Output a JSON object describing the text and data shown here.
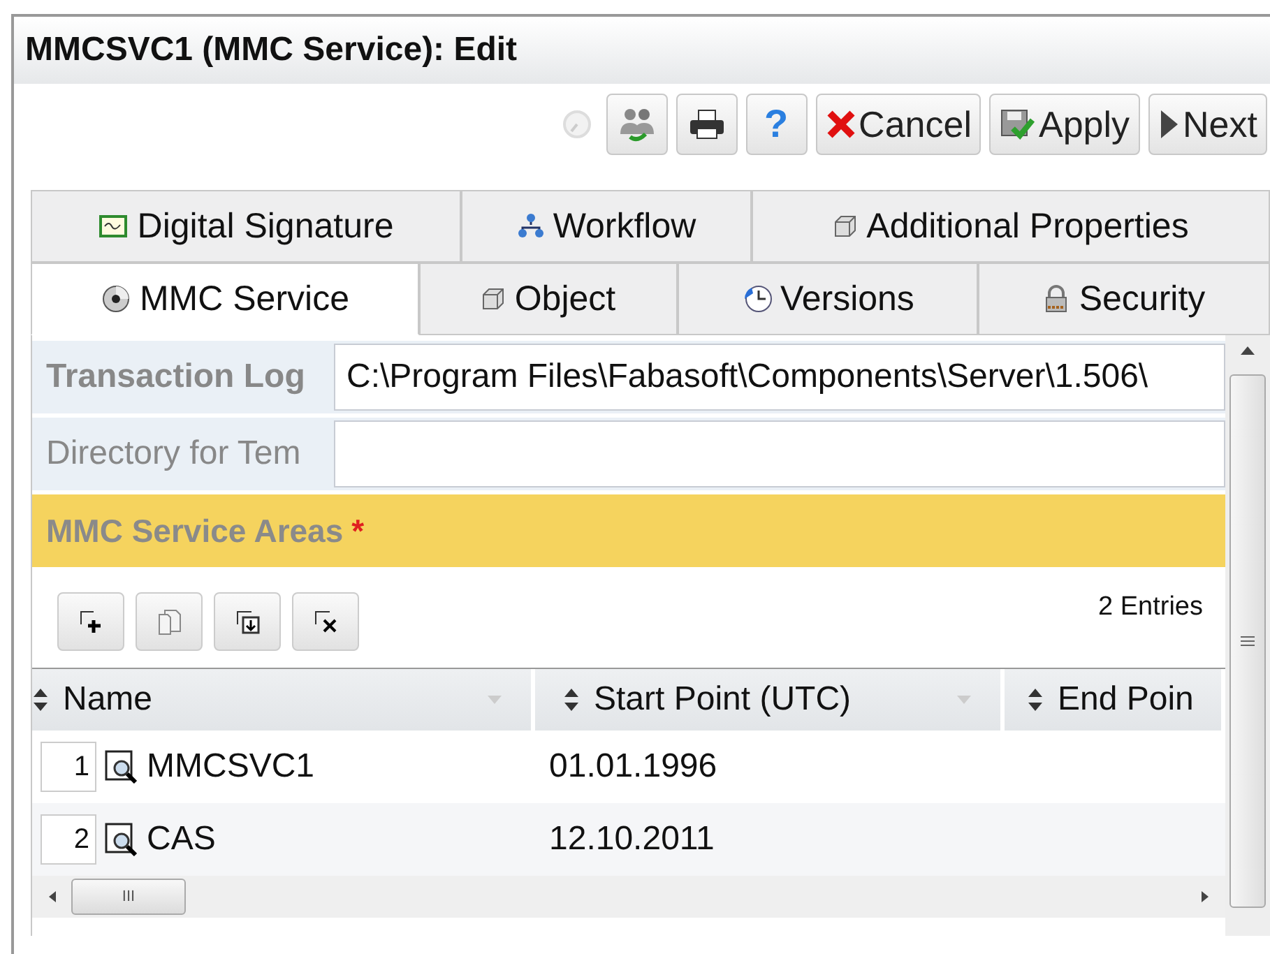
{
  "window": {
    "title": "MMCSVC1 (MMC Service): Edit"
  },
  "toolbar": [
    {
      "kind": "spinner"
    },
    {
      "kind": "users"
    },
    {
      "kind": "print"
    },
    {
      "kind": "help",
      "label": "?"
    },
    {
      "kind": "cancel",
      "label": "Cancel"
    },
    {
      "kind": "apply",
      "label": "Apply"
    },
    {
      "kind": "next",
      "label": "Next"
    }
  ],
  "tab_rows": [
    [
      {
        "label": "Digital Signature",
        "kind": "signature",
        "selected": false
      },
      {
        "label": "Workflow",
        "kind": "workflow",
        "selected": false
      },
      {
        "label": "Additional Properties",
        "kind": "properties",
        "selected": false
      }
    ],
    [
      {
        "label": "MMC Service",
        "kind": "service",
        "selected": true
      },
      {
        "label": "Object",
        "kind": "object",
        "selected": false
      },
      {
        "label": "Versions",
        "kind": "versions",
        "selected": false
      },
      {
        "label": "Security",
        "kind": "security",
        "selected": false
      }
    ]
  ],
  "fields": [
    {
      "label": "Transaction Log",
      "value": "C:\\Program Files\\Fabasoft\\Components\\Server\\1.506\\",
      "bold": true
    },
    {
      "label": "Directory for Tem",
      "bold": false
    }
  ],
  "section": {
    "title": "MMC Service Areas",
    "required_mark": "*"
  },
  "list_tools": [
    {
      "kind": "add"
    },
    {
      "kind": "copy"
    },
    {
      "kind": "insert"
    },
    {
      "kind": "remove"
    }
  ],
  "entries_count": "2 Entries",
  "table": {
    "columns": [
      "Name",
      "Start Point (UTC)",
      "End Poin"
    ],
    "rows": [
      {
        "index": "1",
        "name": "MMCSVC1",
        "start": "01.01.1996"
      },
      {
        "index": "2",
        "name": "CAS",
        "start": "12.10.2011"
      }
    ]
  },
  "hscroll_grip": "III"
}
